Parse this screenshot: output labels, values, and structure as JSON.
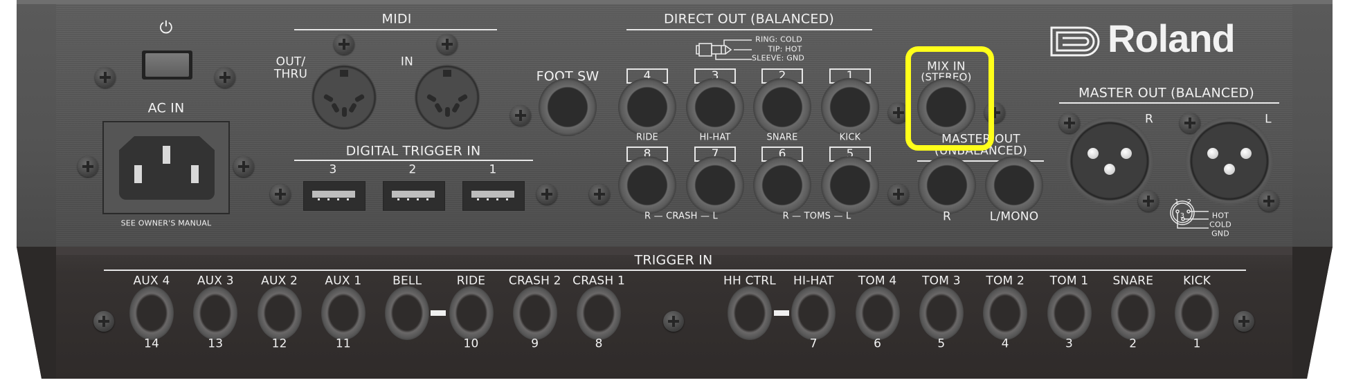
{
  "power": {
    "symbol": "⏻"
  },
  "ac_in": {
    "label": "AC IN",
    "note": "SEE OWNER'S MANUAL"
  },
  "midi": {
    "title": "MIDI",
    "out_label": "OUT/",
    "out_label2": "THRU",
    "in_label": "IN"
  },
  "digital_trigger_in": {
    "title": "DIGITAL TRIGGER IN",
    "ports": [
      "3",
      "2",
      "1"
    ]
  },
  "foot_sw": {
    "label": "FOOT SW"
  },
  "direct_out": {
    "title": "DIRECT OUT (BALANCED)",
    "wiring": {
      "ring": "RING: COLD",
      "tip": "TIP: HOT",
      "sleeve": "SLEEVE: GND"
    },
    "top_row": [
      {
        "number": "4",
        "label": "RIDE"
      },
      {
        "number": "3",
        "label": "HI-HAT"
      },
      {
        "number": "2",
        "label": "SNARE"
      },
      {
        "number": "1",
        "label": "KICK"
      }
    ],
    "bottom_row": [
      {
        "number": "8"
      },
      {
        "number": "7"
      },
      {
        "number": "6"
      },
      {
        "number": "5"
      }
    ],
    "crash_label": "R — CRASH — L",
    "toms_label": "R — TOMS — L"
  },
  "mix_in": {
    "label": "MIX IN",
    "sub": "(STEREO)",
    "highlighted": true,
    "highlight_color": "#ffff1a"
  },
  "master_out_unbalanced": {
    "title": "MASTER OUT",
    "sub": "(UNBALANCED)",
    "r_label": "R",
    "l_label": "L/MONO"
  },
  "brand": {
    "name": "Roland"
  },
  "master_out_balanced": {
    "title": "MASTER OUT (BALANCED)",
    "r_label": "R",
    "l_label": "L"
  },
  "xlr_pinout": {
    "pin1": "1",
    "pin2": "2",
    "pin3": "3",
    "hot": "HOT",
    "cold": "COLD",
    "gnd": "GND"
  },
  "trigger_in": {
    "title": "TRIGGER IN",
    "left_group": [
      {
        "label": "AUX 4",
        "number": "14"
      },
      {
        "label": "AUX 3",
        "number": "13"
      },
      {
        "label": "AUX 2",
        "number": "12"
      },
      {
        "label": "AUX 1",
        "number": "11"
      },
      {
        "label": "BELL",
        "number": ""
      },
      {
        "label": "RIDE",
        "number": "10"
      },
      {
        "label": "CRASH 2",
        "number": "9"
      },
      {
        "label": "CRASH 1",
        "number": "8"
      }
    ],
    "right_group": [
      {
        "label": "HH CTRL",
        "number": ""
      },
      {
        "label": "HI-HAT",
        "number": "7"
      },
      {
        "label": "TOM 4",
        "number": "6"
      },
      {
        "label": "TOM 3",
        "number": "5"
      },
      {
        "label": "TOM 2",
        "number": "4"
      },
      {
        "label": "TOM 1",
        "number": "3"
      },
      {
        "label": "SNARE",
        "number": "2"
      },
      {
        "label": "KICK",
        "number": "1"
      }
    ]
  }
}
